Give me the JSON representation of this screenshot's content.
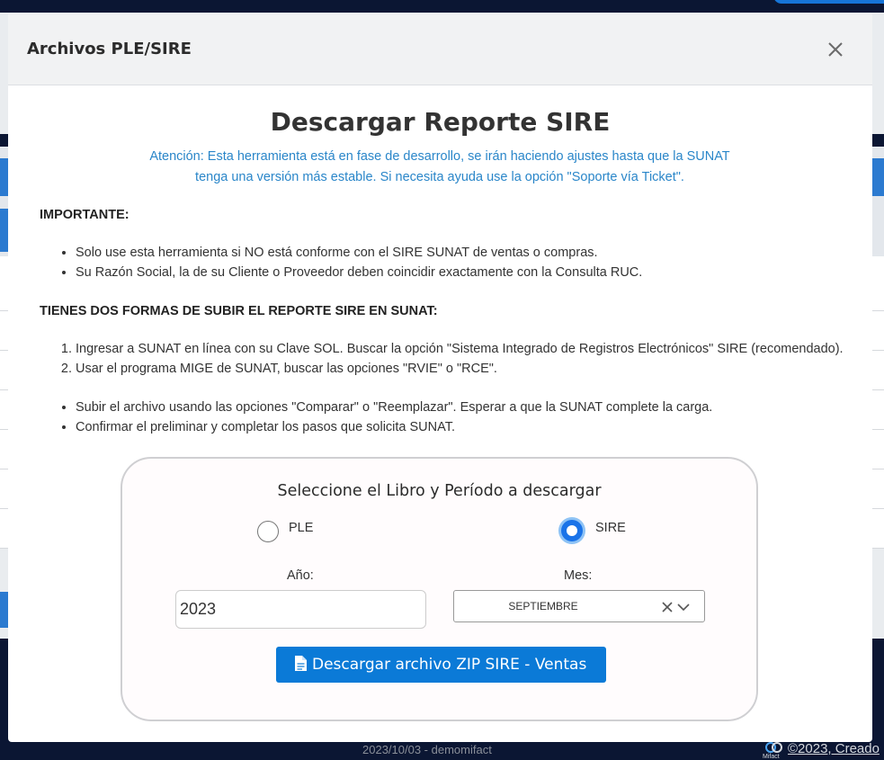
{
  "modal": {
    "title": "Archivos PLE/SIRE",
    "close_icon": "close-icon"
  },
  "report": {
    "title": "Descargar Reporte SIRE",
    "notice_line1": "Atención: Esta herramienta está en fase de desarrollo, se irán haciendo ajustes hasta que la SUNAT",
    "notice_line2": "tenga una versión más estable. Si necesita ayuda use la opción \"Soporte vía Ticket\".",
    "notice_color": "#2a86c9"
  },
  "important": {
    "label": "IMPORTANTE:",
    "items": [
      "Solo use esta herramienta si NO está conforme con el SIRE SUNAT de ventas o compras.",
      "Su Razón Social, la de su Cliente o Proveedor deben coincidir exactamente con la Consulta RUC."
    ]
  },
  "methods": {
    "label": "TIENES DOS FORMAS DE SUBIR EL REPORTE SIRE EN SUNAT:",
    "steps": [
      "Ingresar a SUNAT en línea con su Clave SOL. Buscar la opción \"Sistema Integrado de Registros Electrónicos\" SIRE (recomendado).",
      "Usar el programa MIGE de SUNAT, buscar las opciones \"RVIE\" o \"RCE\"."
    ],
    "notes": [
      "Subir el archivo usando las opciones \"Comparar\" o \"Reemplazar\". Esperar a que la SUNAT complete la carga.",
      "Confirmar el preliminar y completar los pasos que solicita SUNAT."
    ]
  },
  "selector": {
    "title": "Seleccione el Libro y Período a descargar",
    "options": [
      {
        "label": "PLE",
        "selected": false
      },
      {
        "label": "SIRE",
        "selected": true
      }
    ],
    "year_label": "Año:",
    "year_value": "2023",
    "month_label": "Mes:",
    "month_value": "SEPTIEMBRE",
    "download_label": "Descargar archivo ZIP SIRE - Ventas",
    "download_icon": "document-icon",
    "accent_color": "#0b7ad7"
  },
  "footer": {
    "center_text": "2023/10/03 - demomifact",
    "right_text": "©2023, Creado",
    "logo_text": "Mifact"
  }
}
